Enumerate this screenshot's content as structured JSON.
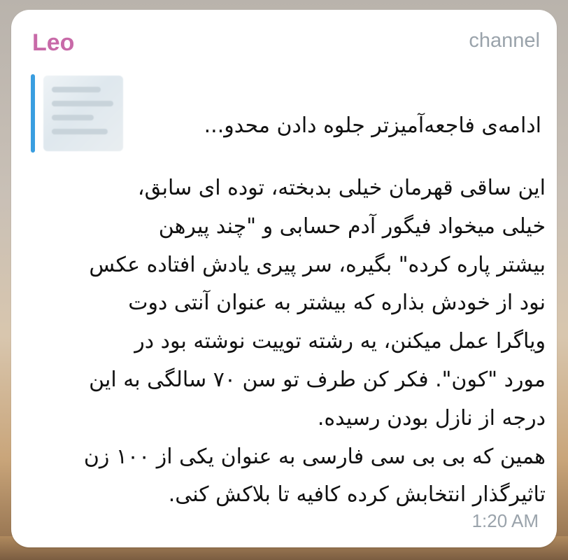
{
  "message": {
    "sender": "Leo",
    "channel_label": "channel",
    "reply_preview": {
      "text": "ادامه‌ی فاجعه‌آمیزتر جلوه دادن محدو..."
    },
    "body_lines": [
      "این ساقی قهرمان خیلی بدبخته، توده ای سابق،",
      "خیلی میخواد فیگور آدم حسابی و \"چند پیرهن",
      "بیشتر پاره کرده\" بگیره، سر پیری یادش افتاده عکس",
      "نود از خودش بذاره که بیشتر به عنوان آنتی دوت",
      "ویاگرا عمل میکنن، یه رشته توییت نوشته بود در",
      "مورد \"کون\". فکر کن طرف تو سن ۷۰ سالگی به این",
      "درجه از نازل بودن رسیده.",
      "همین که بی بی سی فارسی به عنوان یکی از ۱۰۰ زن",
      "تاثیرگذار انتخابش کرده کافیه تا بلاکش کنی."
    ],
    "time": "1:20 AM"
  },
  "colors": {
    "sender_name": "#c86aa8",
    "reply_bar": "#3a9ee0",
    "meta_text": "#9aa3ab",
    "bubble_bg": "#ffffff"
  }
}
